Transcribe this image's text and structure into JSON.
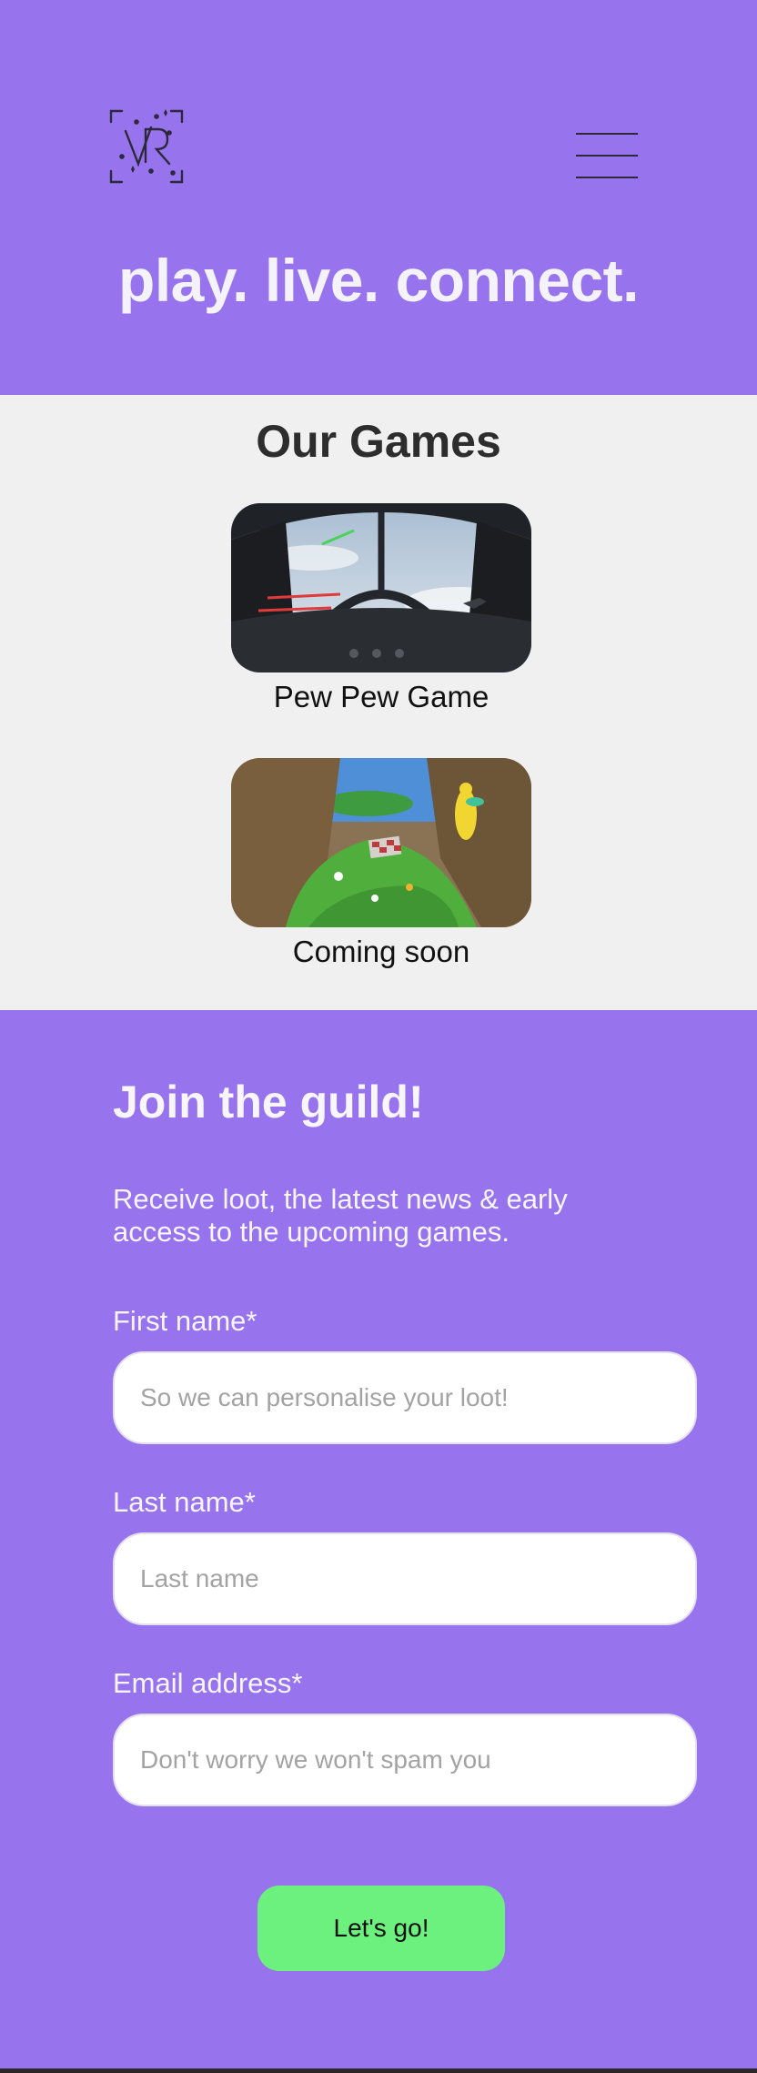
{
  "header": {
    "logo_icon": "vr-logo-icon",
    "menu_icon": "hamburger-menu-icon",
    "hero_title": "play. live. connect."
  },
  "games": {
    "title": "Our Games",
    "items": [
      {
        "label": "Pew Pew Game",
        "image": "space-cockpit-screenshot"
      },
      {
        "label": "Coming soon",
        "image": "forest-valley-screenshot"
      }
    ]
  },
  "signup": {
    "title": "Join the guild!",
    "description": "Receive loot, the latest news & early access to the upcoming games.",
    "fields": [
      {
        "label": "First name*",
        "placeholder": "So we can personalise your loot!",
        "value": ""
      },
      {
        "label": "Last name*",
        "placeholder": "Last name",
        "value": ""
      },
      {
        "label": "Email address*",
        "placeholder": "Don't worry we won't spam you",
        "value": ""
      }
    ],
    "submit_label": "Let's go!"
  },
  "colors": {
    "brand_purple": "#9873ee",
    "games_bg": "#f0f0f0",
    "cta_green": "#6cf17f",
    "dark_text": "#2d2d2d"
  }
}
